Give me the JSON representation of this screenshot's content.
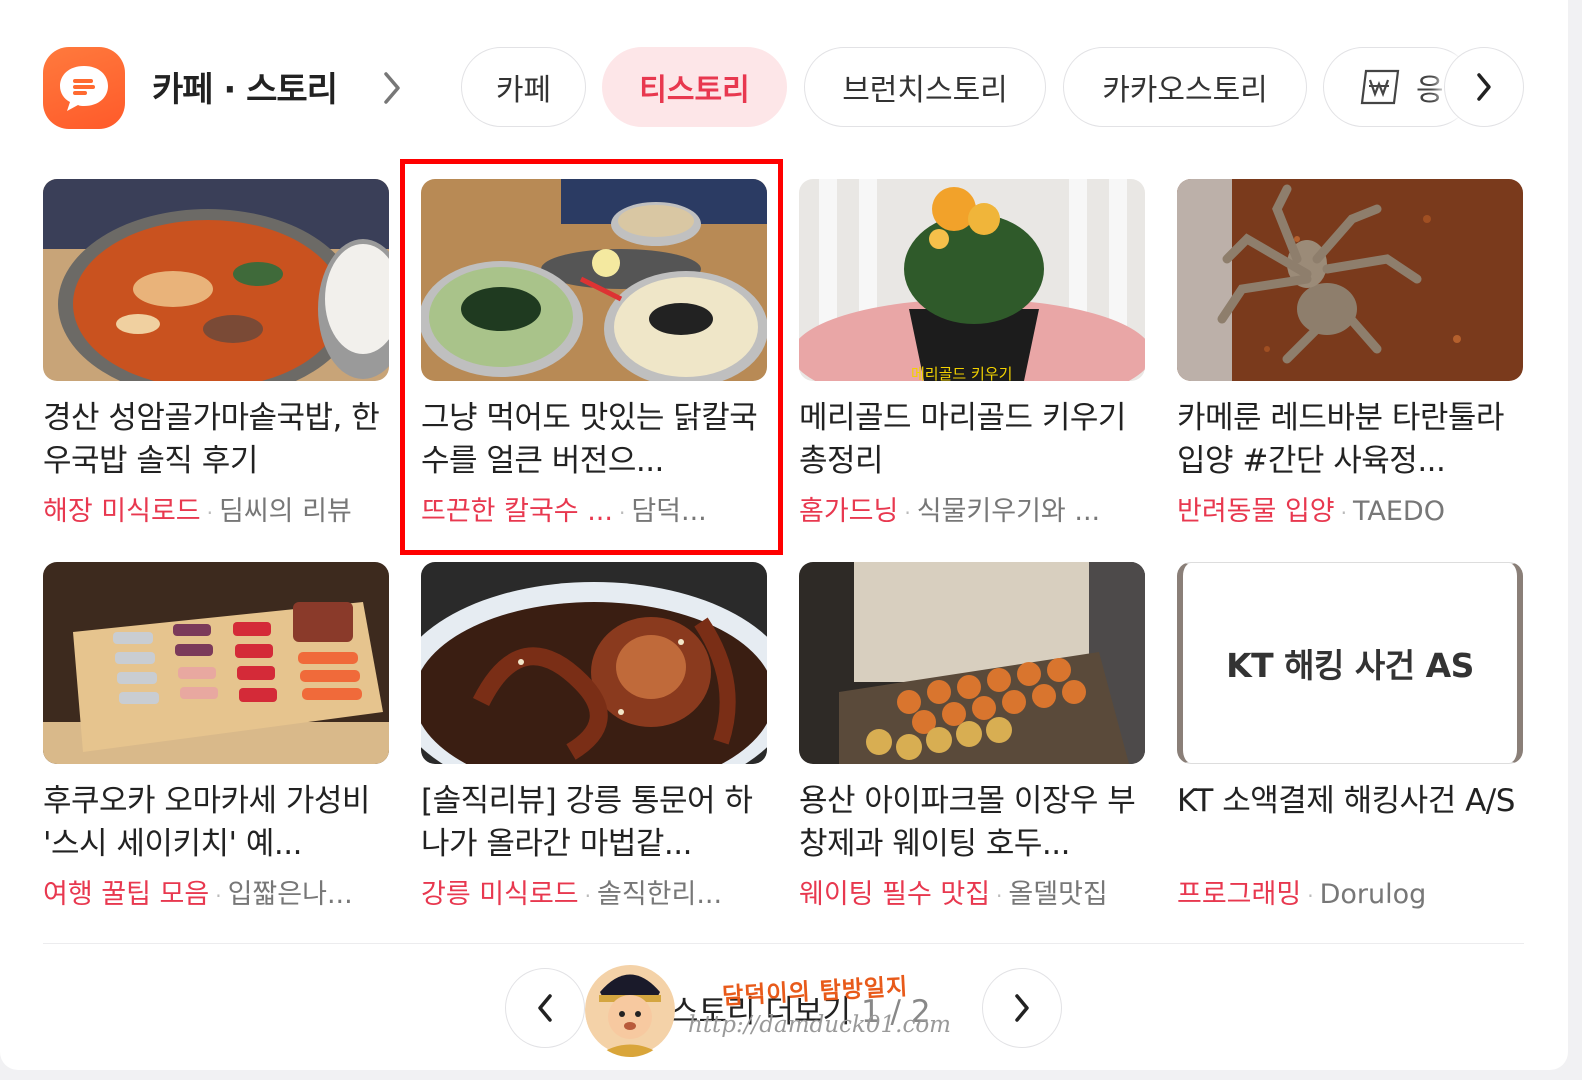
{
  "header": {
    "title": "카페 · 스토리",
    "tabs": [
      {
        "label": "카페",
        "active": false
      },
      {
        "label": "티스토리",
        "active": true
      },
      {
        "label": "브런치스토리",
        "active": false
      },
      {
        "label": "카카오스토리",
        "active": false
      },
      {
        "label": "응",
        "icon": "won-document-icon",
        "active": false
      }
    ]
  },
  "cards": [
    {
      "title": "경산 성암골가마솥국밥, 한우국밥 솔직 후기",
      "category": "해장 미식로드",
      "author": "딤씨의 리뷰"
    },
    {
      "title": "그냥 먹어도 맛있는 닭칼국수를 얼큰 버전으...",
      "category": "뜨끈한 칼국수 ...",
      "author": "담덕..."
    },
    {
      "title": "메리골드 마리골드 키우기 총정리",
      "category": "홈가드닝",
      "author": "식물키우기와 ...",
      "thumb_caption": "메리골드 키우기"
    },
    {
      "title": "카메룬 레드바분 타란툴라 입양 #간단 사육정...",
      "category": "반려동물 입양",
      "author": "TAEDO"
    },
    {
      "title": "후쿠오카 오마카세 가성비 '스시 세이키치' 예...",
      "category": "여행 꿀팁 모음",
      "author": "입짧은나..."
    },
    {
      "title": "[솔직리뷰] 강릉 통문어 하나가 올라간 마법같...",
      "category": "강릉 미식로드",
      "author": "솔직한리..."
    },
    {
      "title": "용산 아이파크몰 이장우 부창제과 웨이팅 호두...",
      "category": "웨이팅 필수 맛집",
      "author": "올델맛집"
    },
    {
      "title": "KT 소액결제 해킹사건 A/S",
      "category": "프로그래밍",
      "author": "Dorulog",
      "thumb_text": "KT 해킹 사건 AS"
    }
  ],
  "pager": {
    "label": "스토리 더보기",
    "page": "1 / 2"
  },
  "watermark": {
    "title": "담덕이의 탐방일지",
    "url": "http://damduck01.com"
  },
  "colors": {
    "accent": "#e8384f",
    "active_tab_bg": "#fde6e8",
    "brand_orange": "#ff6a30",
    "highlight_box": "#ff0000"
  }
}
